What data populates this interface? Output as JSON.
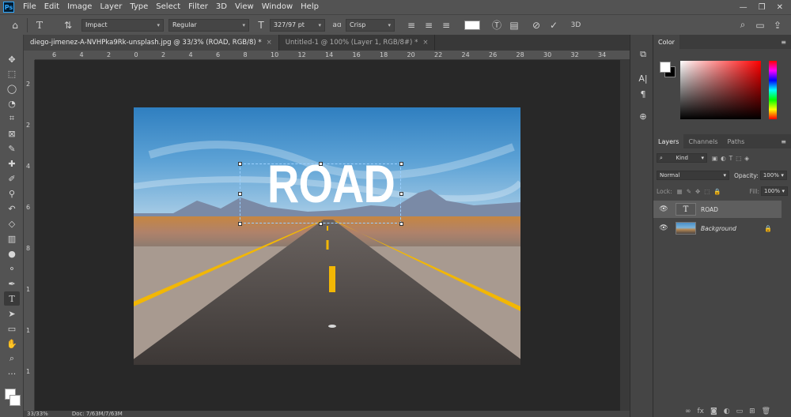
{
  "app": {
    "logo": "Ps"
  },
  "menu": [
    "File",
    "Edit",
    "Image",
    "Layer",
    "Type",
    "Select",
    "Filter",
    "3D",
    "View",
    "Window",
    "Help"
  ],
  "options": {
    "font_family": "Impact",
    "font_style": "Regular",
    "font_size": "327/97 pt",
    "aa_label": "aɑ",
    "antialias": "Crisp",
    "three_d": "3D"
  },
  "tabs": [
    {
      "label": "diego-jimenez-A-NVHPka9Rk-unsplash.jpg @ 33/3% (ROAD, RGB/8) *",
      "active": true
    },
    {
      "label": "Untitled-1 @ 100% (Layer 1, RGB/8#) *",
      "active": false
    }
  ],
  "ruler_h": [
    "6",
    "4",
    "2",
    "0",
    "2",
    "4",
    "6",
    "8",
    "10",
    "12",
    "14",
    "16",
    "18",
    "20",
    "22",
    "24",
    "26",
    "28",
    "30",
    "32",
    "34"
  ],
  "ruler_v": [
    "2",
    "2",
    "4",
    "6",
    "8",
    "1",
    "1",
    "1"
  ],
  "canvas": {
    "text": "ROAD"
  },
  "status": {
    "zoom": "33/33%",
    "doc": "Doc: 7/63M/7/63M"
  },
  "color_panel": {
    "title": "Color"
  },
  "layers_panel": {
    "tabs": [
      "Layers",
      "Channels",
      "Paths"
    ],
    "kind": "Kind",
    "blend_mode": "Normal",
    "opacity_label": "Opacity:",
    "opacity": "100%",
    "lock_label": "Lock:",
    "fill_label": "Fill:",
    "fill": "100%",
    "layers": [
      {
        "name": "ROAD",
        "type": "text",
        "selected": true
      },
      {
        "name": "Background",
        "type": "image",
        "selected": false
      }
    ]
  }
}
